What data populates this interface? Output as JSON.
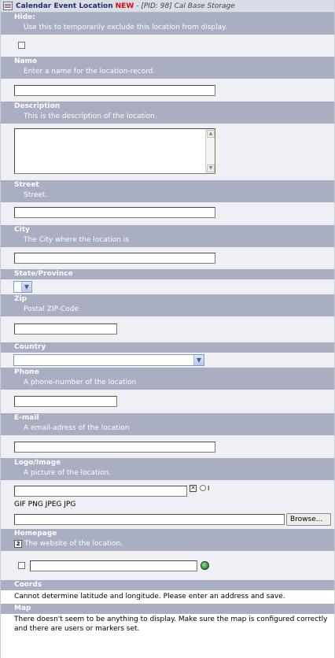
{
  "title": {
    "main": "Calendar Event Location",
    "badge": "NEW",
    "meta": "- [PID: 98] Cal Base Storage"
  },
  "fields": {
    "hide": {
      "label": "Hide:",
      "desc": "Use this to temporarily exclude this location from display."
    },
    "name": {
      "label": "Name",
      "desc": "Enter a name for the location-record.",
      "value": ""
    },
    "description": {
      "label": "Description",
      "desc": "This is the description of the location.",
      "value": ""
    },
    "street": {
      "label": "Street",
      "desc": "Street.",
      "value": ""
    },
    "city": {
      "label": "City",
      "desc": "The City where the location is",
      "value": ""
    },
    "state": {
      "label": "State/Province",
      "value": ""
    },
    "zip": {
      "label": "Zip",
      "desc": "Postal ZIP-Code",
      "value": ""
    },
    "country": {
      "label": "Country",
      "value": ""
    },
    "phone": {
      "label": "Phone",
      "desc": "A phone-number of the location",
      "value": ""
    },
    "email": {
      "label": "E-mail",
      "desc": "A email-adress of the location",
      "value": ""
    },
    "logo": {
      "label": "Logo/Image",
      "desc": "A picture of the location.",
      "allowed": "GIF PNG JPEG JPG",
      "browse": "Browse...",
      "marker": "I"
    },
    "homepage": {
      "label": "Homepage",
      "desc": "The website of the location.",
      "help_icon": "2",
      "value": ""
    },
    "coords": {
      "label": "Coords",
      "message": "Cannot determine latitude and longitude. Please enter an address and save."
    },
    "map": {
      "label": "Map",
      "message": "There doesn't seem to be anything to display. Make sure the map is configured correctly and there are users or markers set."
    }
  }
}
